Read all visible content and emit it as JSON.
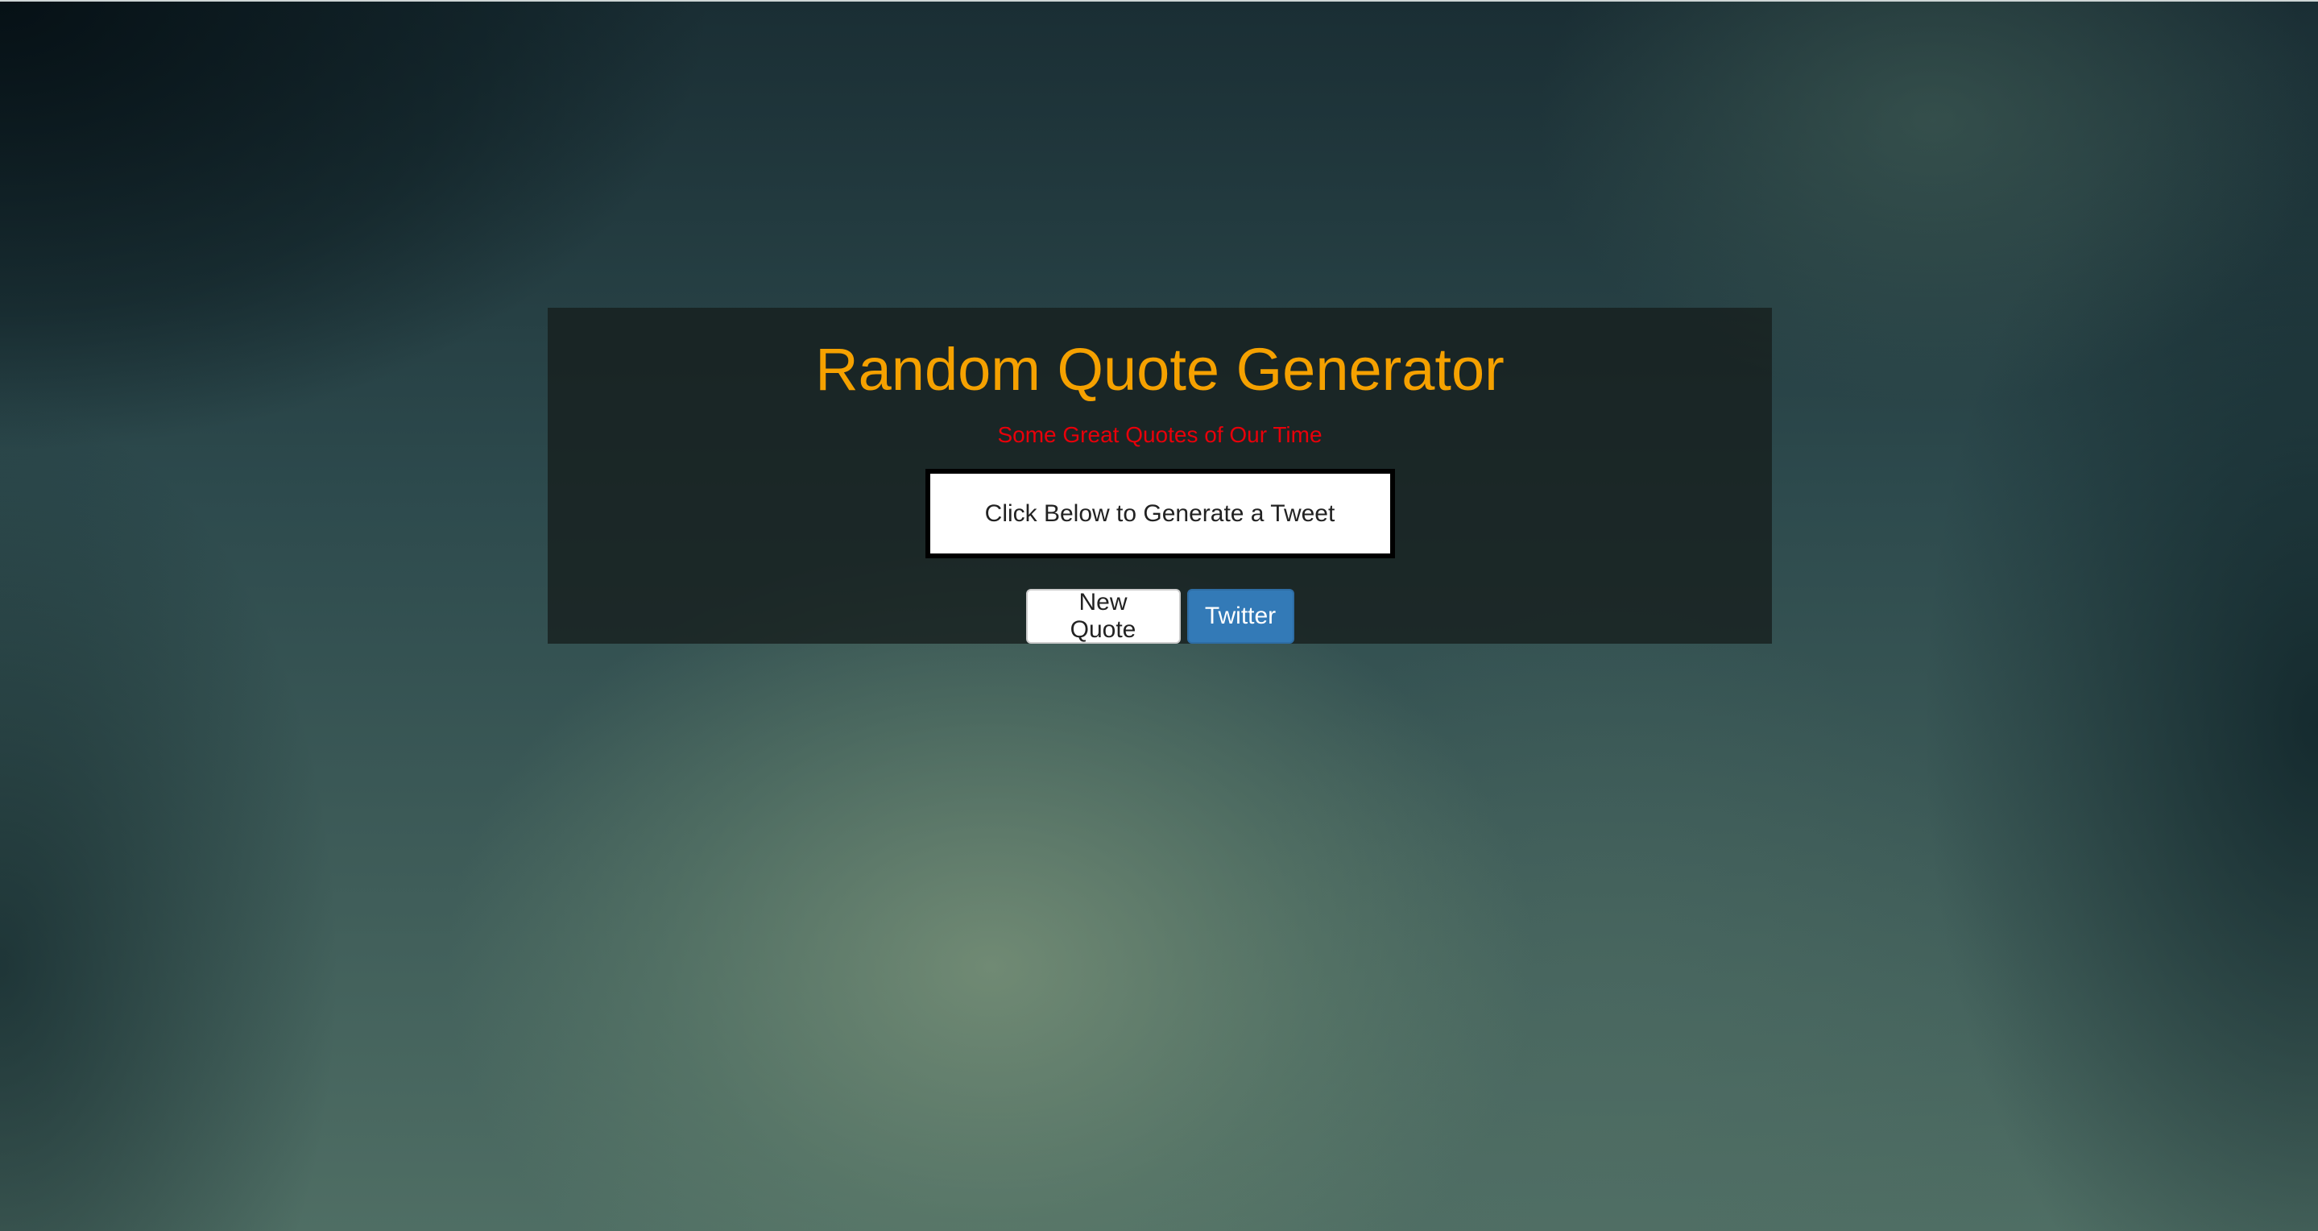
{
  "header": {
    "title": "Random Quote Generator",
    "subtitle": "Some Great Quotes of Our Time"
  },
  "quote": {
    "text": "Click Below to Generate a Tweet"
  },
  "actions": {
    "new_quote_label": "New Quote",
    "twitter_label": "Twitter"
  },
  "colors": {
    "title": "#f5a100",
    "subtitle": "#e8000a",
    "primary_button": "#337ab7"
  }
}
